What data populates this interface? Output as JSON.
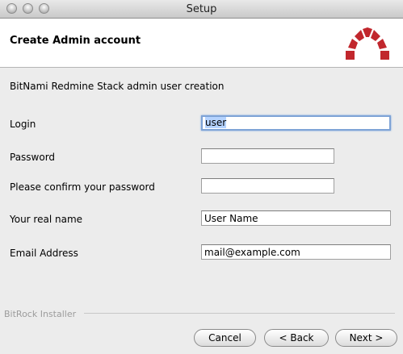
{
  "window": {
    "title": "Setup"
  },
  "header": {
    "title": "Create Admin account"
  },
  "description": "BitNami Redmine Stack admin user creation",
  "form": {
    "login": {
      "label": "Login",
      "value": "user"
    },
    "password": {
      "label": "Password",
      "value": ""
    },
    "confirm": {
      "label": "Please confirm your password",
      "value": ""
    },
    "real_name": {
      "label": "Your real name",
      "value": "User Name"
    },
    "email": {
      "label": "Email Address",
      "value": "mail@example.com"
    }
  },
  "footer": {
    "brand": "BitRock Installer",
    "cancel": "Cancel",
    "back": "< Back",
    "next": "Next >"
  },
  "colors": {
    "logo_red": "#c1272d",
    "focus_ring": "#7ea3d6"
  }
}
